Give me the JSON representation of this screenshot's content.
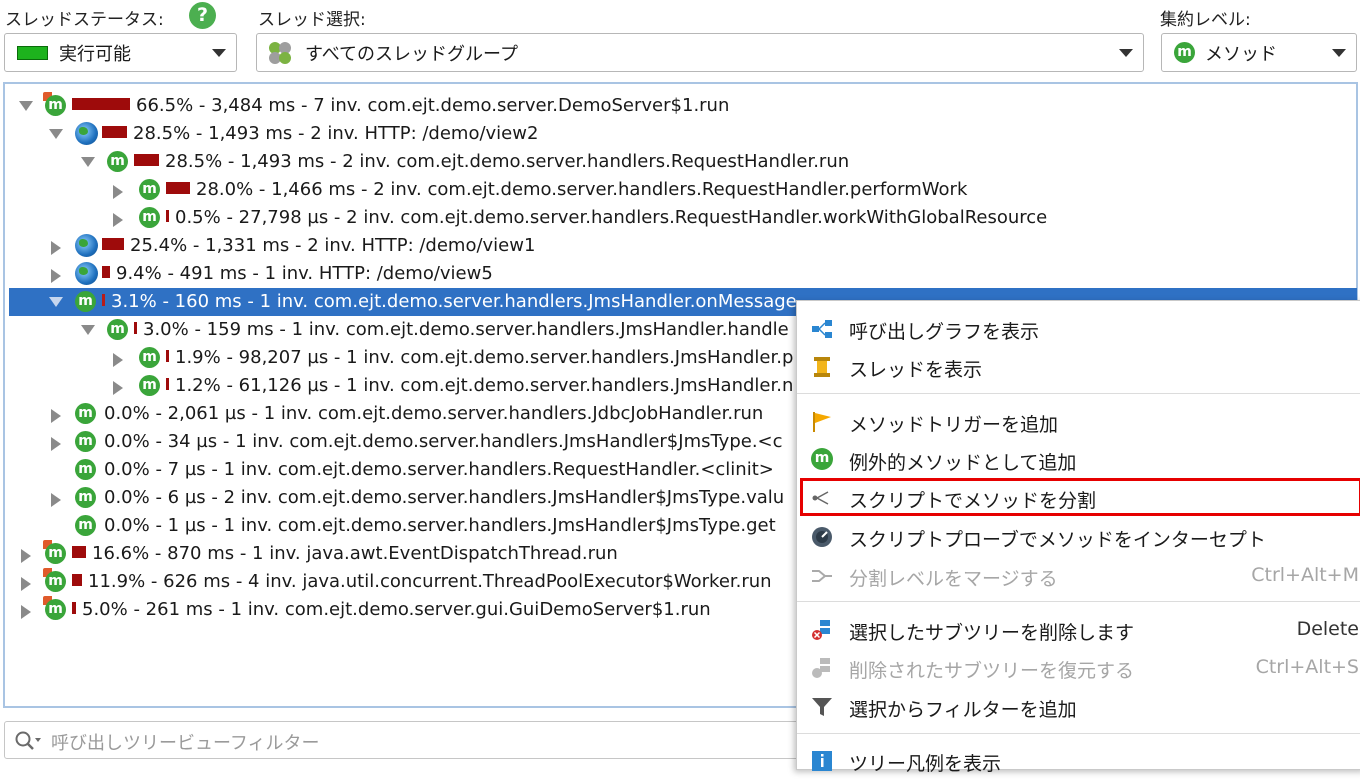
{
  "toolbar": {
    "thread_status_label": "スレッドステータス:",
    "thread_status_value": "実行可能",
    "thread_select_label": "スレッド選択:",
    "thread_select_value": "すべてのスレッドグループ",
    "aggregation_label": "集約レベル:",
    "aggregation_value": "メソッド",
    "help_glyph": "?",
    "status_color": "#1db31d"
  },
  "tree": {
    "rows": [
      {
        "text": "66.5% - 3,484 ms - 7 inv. com.ejt.demo.server.DemoServer$1.run",
        "icon": "method-thread-icon",
        "bar_fraction": 0.665
      },
      {
        "text": "28.5% - 1,493 ms - 2 inv. HTTP: /demo/view2",
        "icon": "globe-icon",
        "bar_fraction": 0.285
      },
      {
        "text": "28.5% - 1,493 ms - 2 inv. com.ejt.demo.server.handlers.RequestHandler.run",
        "icon": "method-icon",
        "bar_fraction": 0.285
      },
      {
        "text": "28.0% - 1,466 ms - 2 inv. com.ejt.demo.server.handlers.RequestHandler.performWork",
        "icon": "method-icon",
        "bar_fraction": 0.28
      },
      {
        "text": "0.5% - 27,798 µs - 2 inv. com.ejt.demo.server.handlers.RequestHandler.workWithGlobalResource",
        "icon": "method-icon",
        "bar_fraction": 0.005
      },
      {
        "text": "25.4% - 1,331 ms - 2 inv. HTTP: /demo/view1",
        "icon": "globe-icon",
        "bar_fraction": 0.254
      },
      {
        "text": "9.4% - 491 ms - 1 inv. HTTP: /demo/view5",
        "icon": "globe-icon",
        "bar_fraction": 0.094
      },
      {
        "text": "3.1% - 160 ms - 1 inv. com.ejt.demo.server.handlers.JmsHandler.onMessage",
        "icon": "method-icon",
        "bar_fraction": 0.031,
        "selected": true
      },
      {
        "text": "3.0% - 159 ms - 1 inv. com.ejt.demo.server.handlers.JmsHandler.handle",
        "icon": "method-icon",
        "bar_fraction": 0.03
      },
      {
        "text": "1.9% - 98,207 µs - 1 inv. com.ejt.demo.server.handlers.JmsHandler.p",
        "icon": "method-icon",
        "bar_fraction": 0.019
      },
      {
        "text": "1.2% - 61,126 µs - 1 inv. com.ejt.demo.server.handlers.JmsHandler.n",
        "icon": "method-icon",
        "bar_fraction": 0.012
      },
      {
        "text": "0.0% - 2,061 µs - 1 inv. com.ejt.demo.server.handlers.JdbcJobHandler.run",
        "icon": "method-icon",
        "bar_fraction": 0
      },
      {
        "text": "0.0% - 34 µs - 1 inv. com.ejt.demo.server.handlers.JmsHandler$JmsType.<c",
        "icon": "method-icon",
        "bar_fraction": 0
      },
      {
        "text": "0.0% - 7 µs - 1 inv. com.ejt.demo.server.handlers.RequestHandler.<clinit>",
        "icon": "method-icon",
        "bar_fraction": 0
      },
      {
        "text": "0.0% - 6 µs - 2 inv. com.ejt.demo.server.handlers.JmsHandler$JmsType.valu",
        "icon": "method-icon",
        "bar_fraction": 0
      },
      {
        "text": "0.0% - 1 µs - 1 inv. com.ejt.demo.server.handlers.JmsHandler$JmsType.get",
        "icon": "method-icon",
        "bar_fraction": 0
      },
      {
        "text": "16.6% - 870 ms - 1 inv. java.awt.EventDispatchThread.run",
        "icon": "method-thread-icon",
        "bar_fraction": 0.166
      },
      {
        "text": "11.9% - 626 ms - 4 inv. java.util.concurrent.ThreadPoolExecutor$Worker.run",
        "icon": "method-thread-icon",
        "bar_fraction": 0.119
      },
      {
        "text": "5.0% - 261 ms - 1 inv. com.ejt.demo.server.gui.GuiDemoServer$1.run",
        "icon": "method-thread-icon",
        "bar_fraction": 0.05
      }
    ]
  },
  "filter": {
    "placeholder": "呼び出しツリービューフィルター"
  },
  "context_menu": {
    "items": [
      {
        "label": "呼び出しグラフを表示",
        "icon": "call-graph-icon",
        "enabled": true
      },
      {
        "label": "スレッドを表示",
        "icon": "thread-spool-icon",
        "enabled": true
      },
      {
        "label": "メソッドトリガーを追加",
        "icon": "flag-icon",
        "enabled": true
      },
      {
        "label": "例外的メソッドとして追加",
        "icon": "method-warning-icon",
        "enabled": true
      },
      {
        "label": "スクリプトでメソッドを分割",
        "icon": "split-icon",
        "enabled": true,
        "highlighted": true
      },
      {
        "label": "スクリプトプローブでメソッドをインターセプト",
        "icon": "probe-icon",
        "enabled": true
      },
      {
        "label": "分割レベルをマージする",
        "icon": "merge-icon",
        "enabled": false,
        "accelerator": "Ctrl+Alt+M"
      },
      {
        "label": "選択したサブツリーを削除します",
        "icon": "delete-subtree-icon",
        "enabled": true,
        "accelerator": "Delete"
      },
      {
        "label": "削除されたサブツリーを復元する",
        "icon": "restore-subtree-icon",
        "enabled": false,
        "accelerator": "Ctrl+Alt+S"
      },
      {
        "label": "選択からフィルターを追加",
        "icon": "filter-icon",
        "enabled": true
      },
      {
        "label": "ツリー凡例を表示",
        "icon": "info-icon",
        "enabled": true
      }
    ]
  },
  "colors": {
    "selection": "#2f71c4",
    "bar": "#9e0b0b",
    "highlight_border": "#e60000"
  }
}
